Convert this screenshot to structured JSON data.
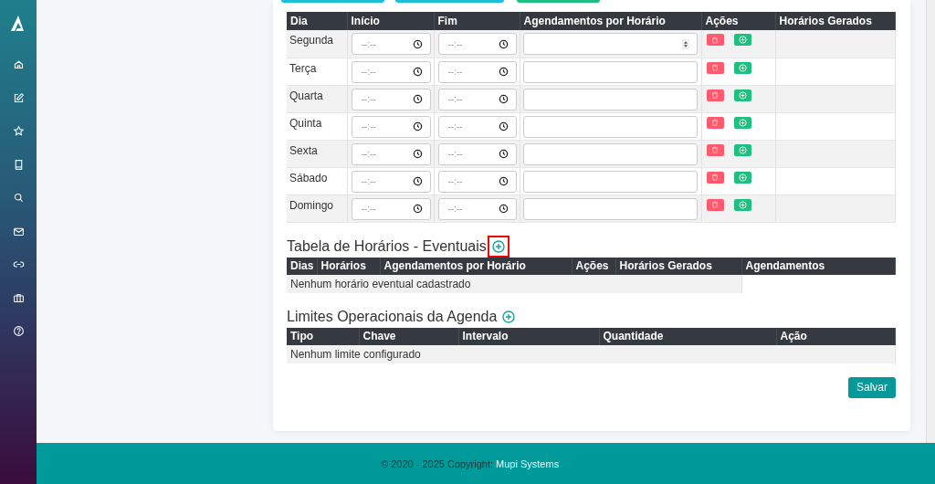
{
  "top_buttons": [
    {
      "color": "#1cbfd9"
    },
    {
      "color": "#1cbfd9"
    },
    {
      "color": "#1fc07f"
    }
  ],
  "weekly_table": {
    "columns": [
      "Dia",
      "Início",
      "Fim",
      "Agendamentos por Horário",
      "Ações",
      "Horários Gerados"
    ],
    "rows": [
      {
        "day": "Segunda",
        "start": "--:--",
        "end": "--:--",
        "spinner": true
      },
      {
        "day": "Terça",
        "start": "--:--",
        "end": "--:--",
        "spinner": false
      },
      {
        "day": "Quarta",
        "start": "--:--",
        "end": "--:--",
        "spinner": false
      },
      {
        "day": "Quinta",
        "start": "--:--",
        "end": "--:--",
        "spinner": false
      },
      {
        "day": "Sexta",
        "start": "--:--",
        "end": "--:--",
        "spinner": false
      },
      {
        "day": "Sábado",
        "start": "--:--",
        "end": "--:--",
        "spinner": false
      },
      {
        "day": "Domingo",
        "start": "--:--",
        "end": "--:--",
        "spinner": false
      }
    ]
  },
  "eventual": {
    "title": "Tabela de Horários - Eventuais",
    "highlighted": true,
    "columns": [
      "Dias",
      "Horários",
      "Agendamentos por Horário",
      "Ações",
      "Horários Gerados",
      "Agendamentos"
    ],
    "empty": "Nenhum horário eventual cadastrado"
  },
  "limits": {
    "title": "Limites Operacionais da Agenda",
    "highlighted": false,
    "columns": [
      "Tipo",
      "Chave",
      "Intervalo",
      "Quantidade",
      "Ação"
    ],
    "empty": "Nenhum limite configurado"
  },
  "save_button": "Salvar",
  "footer": {
    "text": "© 2020 - 2025 Copyright:",
    "link": "Mupi Systems"
  }
}
